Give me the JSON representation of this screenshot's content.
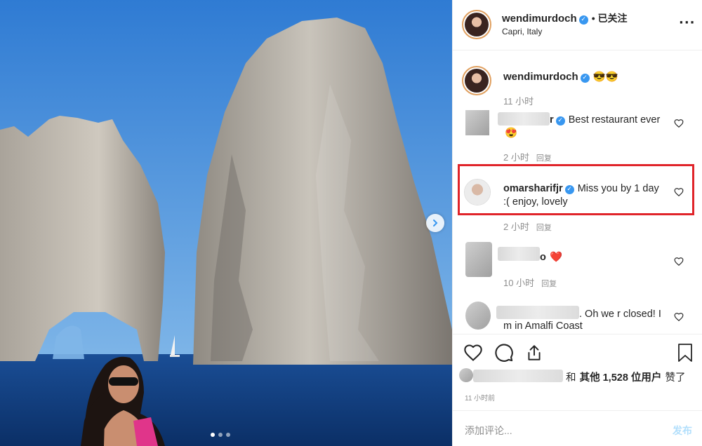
{
  "post_header": {
    "username": "wendimurdoch",
    "follow_status": "已关注",
    "location": "Capri, Italy",
    "more_icon": "more-horizontal-icon"
  },
  "caption": {
    "username": "wendimurdoch",
    "text": "😎😎",
    "time": "11 小时"
  },
  "comments": [
    {
      "username_partial": "r",
      "text_line1": "Best restaurant ever",
      "text_line2": "😍",
      "time": "2 小时",
      "reply_label": "回复",
      "blurred": true
    },
    {
      "username": "omarsharifjr",
      "text_line1": "Miss you by 1 day",
      "text_line2": ":( enjoy, lovely",
      "time": "2 小时",
      "reply_label": "回复",
      "highlighted": true
    },
    {
      "username_partial": "o",
      "text_line1": "❤️",
      "time": "10 小时",
      "reply_label": "回复",
      "blurred": true
    },
    {
      "username_partial": "",
      "text_line1": ". Oh we r closed! I",
      "text_line2": "m in Amalfi Coast",
      "blurred": true
    }
  ],
  "actions": {
    "like_icon": "heart-icon",
    "comment_icon": "comment-icon",
    "share_icon": "share-icon",
    "save_icon": "bookmark-icon"
  },
  "likes": {
    "prefix": "和",
    "bold_text": "其他 1,528 位用户",
    "suffix": "赞了"
  },
  "timestamp": "11 小时前",
  "add_comment": {
    "placeholder": "添加评论...",
    "post_label": "发布"
  },
  "carousel": {
    "total_dots": 3,
    "active_index": 0
  },
  "colors": {
    "verified": "#3897f0",
    "highlight": "#e0242a",
    "post_disabled": "#b2dffc",
    "sky": "#3f84d6",
    "sea": "#0f3f82"
  }
}
